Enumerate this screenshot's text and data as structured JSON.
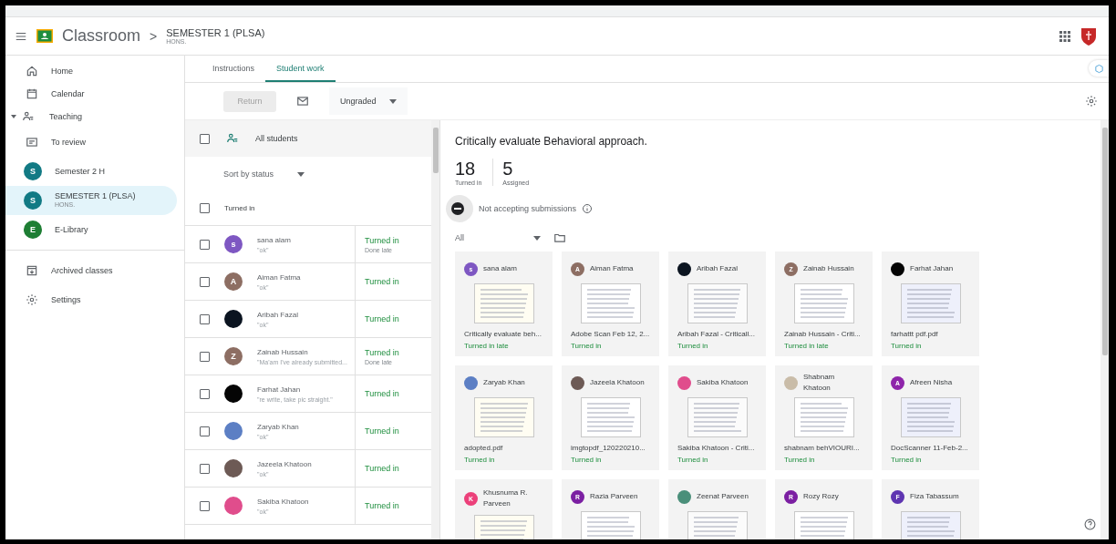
{
  "header": {
    "app_name": "Classroom",
    "separator": ">",
    "class_name": "SEMESTER 1 (PLSA)",
    "class_section": "HONS."
  },
  "sidebar": {
    "items": [
      {
        "kind": "home",
        "label": "Home",
        "selected": false
      },
      {
        "kind": "calendar",
        "label": "Calendar",
        "selected": false
      },
      {
        "kind": "section",
        "label": "Teaching",
        "expanded": true
      },
      {
        "kind": "review",
        "label": "To review",
        "selected": false
      },
      {
        "kind": "class",
        "letter": "S",
        "color": "#127a84",
        "label": "Semester 2 H",
        "selected": false
      },
      {
        "kind": "class",
        "letter": "S",
        "color": "#127a84",
        "label": "SEMESTER 1 (PLSA)",
        "sub": "HONS.",
        "selected": true
      },
      {
        "kind": "class",
        "letter": "E",
        "color": "#1e7e34",
        "label": "E-Library",
        "selected": false
      },
      {
        "kind": "divider"
      },
      {
        "kind": "archive",
        "label": "Archived classes",
        "selected": false
      },
      {
        "kind": "settings",
        "label": "Settings",
        "selected": false
      }
    ]
  },
  "tabs": [
    {
      "label": "Instructions",
      "selected": false
    },
    {
      "label": "Student work",
      "selected": true
    }
  ],
  "toolbar": {
    "return_label": "Return",
    "return_disabled": true,
    "grade_filter": "Ungraded"
  },
  "student_list": {
    "all_label": "All students",
    "all_checked": false,
    "sort_label": "Sort by status",
    "group_label": "Turned in",
    "group_checked": false,
    "rows": [
      {
        "name": "sana alam",
        "comment": "\"ok\"",
        "status": "Turned in",
        "note": "Done late",
        "checked": false,
        "avatar": {
          "kind": "letter",
          "letter": "s",
          "color": "#7e57c2"
        }
      },
      {
        "name": "Aiman Fatma",
        "comment": "\"ok\"",
        "status": "Turned in",
        "checked": false,
        "avatar": {
          "kind": "letter",
          "letter": "A",
          "color": "#8d6e63"
        }
      },
      {
        "name": "Aribah Fazal",
        "comment": "\"ok\"",
        "status": "Turned in",
        "checked": false,
        "avatar": {
          "kind": "photo",
          "color": "#0b1420"
        }
      },
      {
        "name": "Zainab Hussain",
        "comment": "\"Ma'am I've already submitted...",
        "status": "Turned in",
        "note": "Done late",
        "checked": false,
        "avatar": {
          "kind": "letter",
          "letter": "Z",
          "color": "#8d6e63"
        }
      },
      {
        "name": "Farhat Jahan",
        "comment": "\"re write, take pic straight.\"",
        "status": "Turned in",
        "checked": false,
        "avatar": {
          "kind": "photo",
          "color": "#050505"
        }
      },
      {
        "name": "Zaryab Khan",
        "comment": "\"ok\"",
        "status": "Turned in",
        "checked": false,
        "avatar": {
          "kind": "photo",
          "color": "#5c7fc4"
        }
      },
      {
        "name": "Jazeela Khatoon",
        "comment": "\"ok\"",
        "status": "Turned in",
        "checked": false,
        "avatar": {
          "kind": "photo",
          "color": "#6d5a55"
        }
      },
      {
        "name": "Sakiba Khatoon",
        "comment": "\"ok\"",
        "status": "Turned in",
        "checked": false,
        "avatar": {
          "kind": "photo",
          "color": "#e04d8c"
        }
      }
    ]
  },
  "assignment": {
    "title": "Critically evaluate Behavioral approach.",
    "stats": [
      {
        "value": "18",
        "label": "Turned in"
      },
      {
        "value": "5",
        "label": "Assigned"
      }
    ],
    "accepting": false,
    "accepting_label": "Not accepting submissions",
    "filter": "All",
    "cards": [
      {
        "name": "sana alam",
        "file": "Critically evaluate beh...",
        "status": "Turned in late",
        "avatar": {
          "kind": "letter",
          "letter": "s",
          "color": "#7e57c2"
        }
      },
      {
        "name": "Aiman Fatma",
        "file": "Adobe Scan Feb 12, 2...",
        "status": "Turned in",
        "avatar": {
          "kind": "letter",
          "letter": "A",
          "color": "#8d6e63"
        }
      },
      {
        "name": "Aribah Fazal",
        "file": "Aribah Fazal - Criticall...",
        "status": "Turned in",
        "avatar": {
          "kind": "photo",
          "color": "#0b1420"
        }
      },
      {
        "name": "Zainab Hussain",
        "file": "Zainab Hussain - Criti...",
        "status": "Turned in late",
        "avatar": {
          "kind": "letter",
          "letter": "Z",
          "color": "#8d6e63"
        }
      },
      {
        "name": "Farhat Jahan",
        "file": "farhattt pdf.pdf",
        "status": "Turned in",
        "avatar": {
          "kind": "photo",
          "color": "#050505"
        }
      },
      {
        "name": "Zaryab Khan",
        "file": "adopted.pdf",
        "status": "Turned in",
        "avatar": {
          "kind": "photo",
          "color": "#5c7fc4"
        }
      },
      {
        "name": "Jazeela Khatoon",
        "file": "imgtopdf_120220210...",
        "status": "Turned in",
        "avatar": {
          "kind": "photo",
          "color": "#6d5a55"
        }
      },
      {
        "name": "Sakiba Khatoon",
        "file": "Sakiba Khatoon - Criti...",
        "status": "Turned in",
        "avatar": {
          "kind": "photo",
          "color": "#e04d8c"
        }
      },
      {
        "name": "Shabnam Khatoon",
        "file": "shabnam behVIOURI...",
        "status": "Turned in",
        "avatar": {
          "kind": "photo",
          "color": "#c9bca8"
        }
      },
      {
        "name": "Afreen Nisha",
        "file": "DocScanner 11-Feb-2...",
        "status": "Turned in",
        "avatar": {
          "kind": "letter",
          "letter": "A",
          "color": "#8e24aa"
        }
      },
      {
        "name": "Khusnuma R. Parveen",
        "avatar": {
          "kind": "letter",
          "letter": "K",
          "color": "#ec407a"
        }
      },
      {
        "name": "Razia Parveen",
        "avatar": {
          "kind": "letter",
          "letter": "R",
          "color": "#7b1fa2"
        }
      },
      {
        "name": "Zeenat Parveen",
        "avatar": {
          "kind": "photo",
          "color": "#4a8f7a"
        }
      },
      {
        "name": "Rozy Rozy",
        "avatar": {
          "kind": "letter",
          "letter": "R",
          "color": "#7b1fa2"
        }
      },
      {
        "name": "Fiza Tabassum",
        "avatar": {
          "kind": "letter",
          "letter": "F",
          "color": "#5e35b1"
        }
      }
    ]
  }
}
